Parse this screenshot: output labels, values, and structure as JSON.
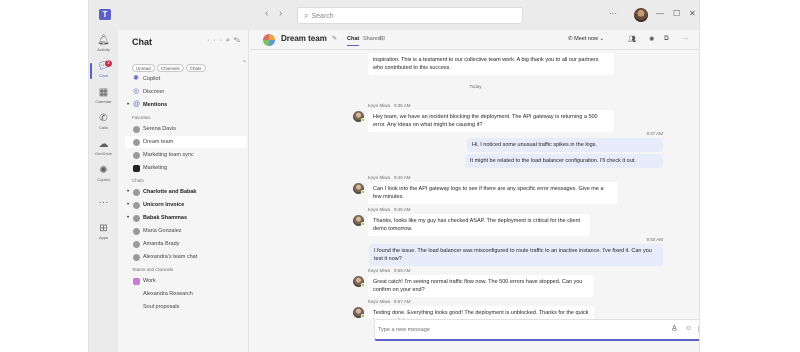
{
  "titlebar": {
    "logo_text": "T",
    "back_icon": "chevron-left-icon",
    "forward_icon": "chevron-right-icon",
    "search_placeholder": "Search",
    "more_label": "···",
    "minimize_label": "—",
    "maximize_label": "☐",
    "close_label": "✕"
  },
  "rail": {
    "items": [
      {
        "label": "Activity",
        "icon": "bell-icon",
        "glyph": "🔔︎"
      },
      {
        "label": "Chat",
        "icon": "chat-icon",
        "glyph": "💬︎",
        "badge": "2"
      },
      {
        "label": "Calendar",
        "icon": "calendar-icon",
        "glyph": "▦"
      },
      {
        "label": "Calls",
        "icon": "phone-icon",
        "glyph": "✆"
      },
      {
        "label": "OneDrive",
        "icon": "cloud-icon",
        "glyph": "☁"
      },
      {
        "label": "Copilot",
        "icon": "copilot-icon",
        "glyph": "✺"
      },
      {
        "label": "",
        "icon": "more-icon",
        "glyph": "···"
      },
      {
        "label": "Apps",
        "icon": "apps-icon",
        "glyph": "⊞"
      }
    ]
  },
  "chatlist": {
    "title": "Chat",
    "more_icon": "···",
    "search_icon": "⌕",
    "compose_icon": "✎",
    "filters": [
      "Unread",
      "Channels",
      "Chats"
    ],
    "pinned": [
      {
        "label": "Copilot",
        "icon": "copilot-icon",
        "glyph": "✺"
      },
      {
        "label": "Discover",
        "icon": "discover-icon",
        "glyph": "◎"
      },
      {
        "label": "Mentions",
        "icon": "at-icon",
        "glyph": "@",
        "bold": true,
        "dot": true
      }
    ],
    "favorites_label": "Favorites",
    "favorites": [
      {
        "label": "Serena Davis"
      },
      {
        "label": "Dream team",
        "selected": true
      },
      {
        "label": "Marketing team sync"
      },
      {
        "label": "Marketing",
        "square": true,
        "dark": true
      }
    ],
    "chats_label": "Chats",
    "chats": [
      {
        "label": "Charlotte and Babak",
        "bold": true,
        "dot": true
      },
      {
        "label": "Unicorn Invoice",
        "bold": true,
        "dot": true
      },
      {
        "label": "Babak Shammas",
        "bold": true,
        "dot": true
      },
      {
        "label": "Maria Gonzalez"
      },
      {
        "label": "Amanda Brady"
      },
      {
        "label": "Alexandra's team chat"
      }
    ],
    "teams_label": "Teams and channels",
    "teams": [
      {
        "label": "Work",
        "square": true
      },
      {
        "label": "Alexandra Research",
        "noicon": true
      },
      {
        "label": "Soul proposals",
        "noicon": true
      }
    ]
  },
  "header": {
    "title": "Dream team",
    "edit_icon": "✎",
    "tabs": [
      "Chat",
      "Shared"
    ],
    "add_tab": "⊞",
    "meet_label": "Meet now",
    "meet_icon": "✆",
    "meet_chevron": "⌄",
    "people_icon": "👥︎",
    "copilot_icon": "✺",
    "share_icon": "⧉",
    "more_icon": "···"
  },
  "messages": [
    {
      "type": "in",
      "sender": "",
      "time": "",
      "text": "inspiration. This is a testament to our collective team work. A big thank you to all our partners who contributed to this success.",
      "avatar": false
    },
    {
      "type": "day",
      "text": "Today"
    },
    {
      "type": "in",
      "sender": "Kayo Miwa",
      "time": "9:35 AM",
      "text": "Hey team, we have an incident blocking the deployment. The API gateway is returning a 500 error. Any ideas on what might be causing it?",
      "avatar": true
    },
    {
      "type": "out",
      "time": "9:37 AM",
      "text": "Hi, I noticed some unusual traffic spikes in the logs."
    },
    {
      "type": "out",
      "time": "",
      "text": "It might be related to the load balancer configuration. I'll check it out."
    },
    {
      "type": "in",
      "sender": "Kayo Miwa",
      "time": "9:40 AM",
      "text": "Can I look into the API gateway logs to see if there are any specific error messages. Give me a few minutes.",
      "avatar": true
    },
    {
      "type": "in",
      "sender": "Kayo Miwa",
      "time": "9:45 AM",
      "text": "Thanks, looks like my guy has checked ASAP. The deployment is critical for the client demo tomorrow.",
      "avatar": true
    },
    {
      "type": "out",
      "time": "9:50 AM",
      "text": "I found the issue. The load balancer was misconfigured to route traffic to an inactive instance. I've fixed it. Can you test it now?"
    },
    {
      "type": "in",
      "sender": "Kayo Miwa",
      "time": "9:55 AM",
      "text": "Great catch! I'm seeing normal traffic flow now. The 500 errors have stopped. Can you confirm on your end?",
      "avatar": true
    },
    {
      "type": "in",
      "sender": "Kayo Miwa",
      "time": "9:57 AM",
      "text": "Testing done. Everything looks good! The deployment is unblocked. Thanks for the quick turnaround, team.",
      "avatar": true
    }
  ],
  "compose": {
    "placeholder": "Type a new message",
    "format_icon": "A̲",
    "emoji_icon": "☺",
    "gif_icon": "▣",
    "loop_icon": "⟳",
    "attach_icon": "+",
    "send_icon": "➤"
  }
}
